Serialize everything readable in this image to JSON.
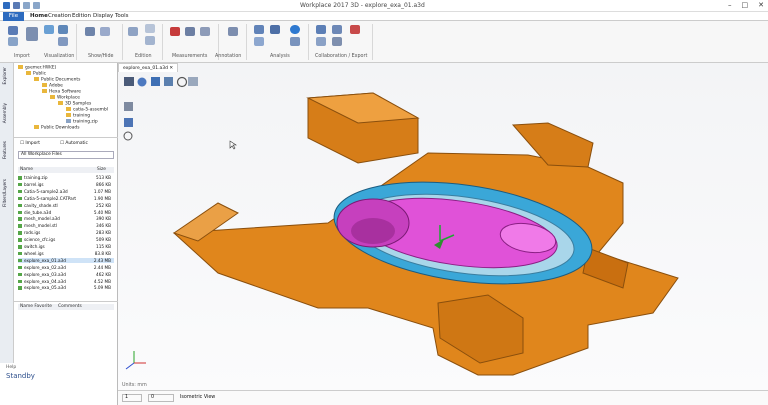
{
  "window": {
    "title": "Workplace 2017 3D - explore_exa_01.a3d"
  },
  "ribbon_tabs": [
    "File",
    "Home",
    "Creation",
    "Edition",
    "Display",
    "Tools"
  ],
  "ribbon_groups": [
    "Import",
    "Visualization",
    "Show/Hide",
    "Edition",
    "Measurements",
    "Annotation",
    "Analysis",
    "Collaboration / Export"
  ],
  "side_tabs": [
    "Explorer",
    "Assembly",
    "Features",
    "Filters/Layers"
  ],
  "tree": [
    {
      "label": "gsemer.HW(E)",
      "indent": 0
    },
    {
      "label": "Public",
      "indent": 1
    },
    {
      "label": "Public Documents",
      "indent": 2
    },
    {
      "label": "Adobe",
      "indent": 3
    },
    {
      "label": "Hexa Software",
      "indent": 3
    },
    {
      "label": "Workplace",
      "indent": 4
    },
    {
      "label": "3D Samples",
      "indent": 5
    },
    {
      "label": "catia-5-assembl",
      "indent": 6
    },
    {
      "label": "training",
      "indent": 6
    },
    {
      "label": "training.zip",
      "indent": 6
    },
    {
      "label": "Public Downloads",
      "indent": 2
    }
  ],
  "options": {
    "import": "Import",
    "automatic": "Automatic",
    "filter": "All Workplace Files"
  },
  "file_columns": {
    "name": "Name",
    "size": "Size"
  },
  "files": [
    {
      "name": "training.zip",
      "size": "513 KB"
    },
    {
      "name": "barrel.igs",
      "size": "866 KB"
    },
    {
      "name": "Catia-5-sample2.a3d",
      "size": "1.07 MB"
    },
    {
      "name": "Catia-5-sample2.CATPart",
      "size": "1.90 MB"
    },
    {
      "name": "cavity_shade.stl",
      "size": "252 KB"
    },
    {
      "name": "die_tube.a3d",
      "size": "5.40 MB"
    },
    {
      "name": "mesh_model.a3d",
      "size": "390 KB"
    },
    {
      "name": "mesh_model.stl",
      "size": "346 KB"
    },
    {
      "name": "rods.igs",
      "size": "283 KB"
    },
    {
      "name": "science_cfc.igs",
      "size": "509 KB"
    },
    {
      "name": "switch.igs",
      "size": "115 KB"
    },
    {
      "name": "wheel.igs",
      "size": "83.8 KB"
    },
    {
      "name": "explore_exa_01.a3d",
      "size": "2.43 MB"
    },
    {
      "name": "explore_exa_02.a3d",
      "size": "2.44 MB"
    },
    {
      "name": "explore_exa_03.a3d",
      "size": "462 KB"
    },
    {
      "name": "explore_exa_04.a3d",
      "size": "4.52 MB"
    },
    {
      "name": "explore_exa_05.a3d",
      "size": "5.09 MB"
    }
  ],
  "favorites": {
    "name": "Name Favorite",
    "comments": "Comments"
  },
  "help": {
    "title": "Help",
    "status": "Standby"
  },
  "doc_tab": "explore_exa_01.a3d",
  "units": "Units: mm",
  "status": {
    "page": "1",
    "zoom": "0",
    "view": "Isometric View"
  },
  "colors": {
    "accent": "#2d6bbf",
    "part_orange": "#e0861c",
    "cavity_blue": "#3aa7d8",
    "cavity_magenta": "#e052d8"
  }
}
